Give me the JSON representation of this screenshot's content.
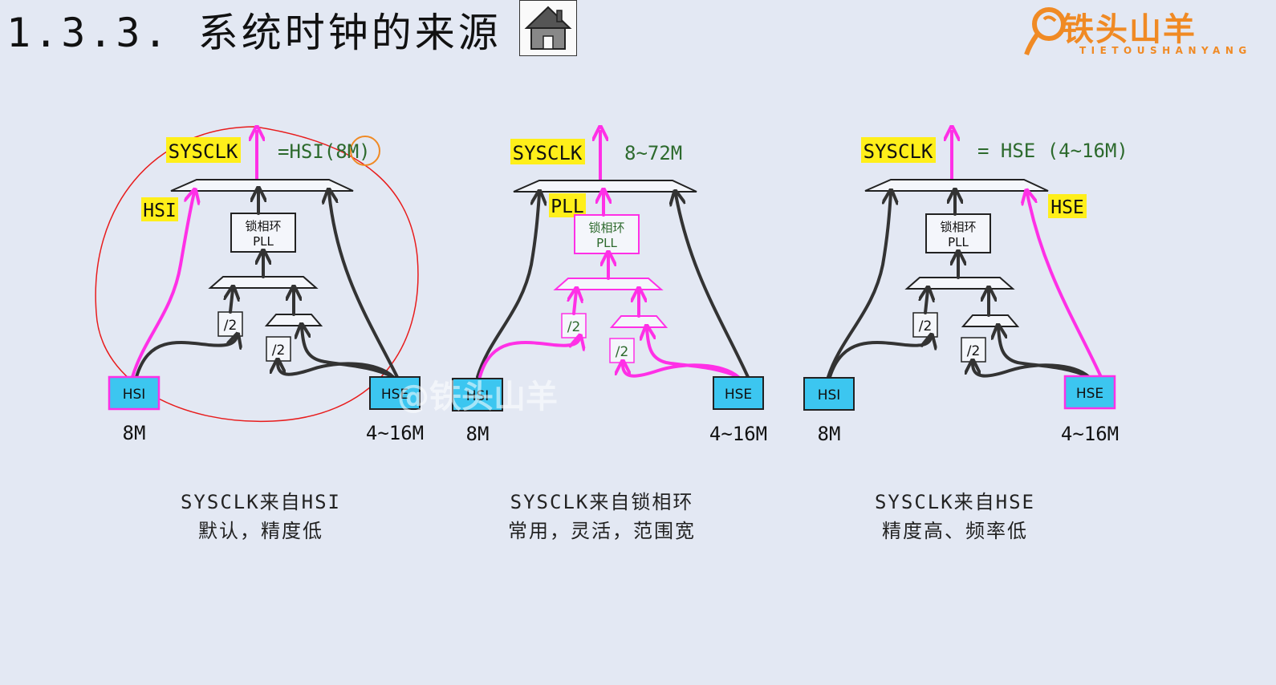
{
  "page": {
    "title": "1.3.3. 系统时钟的来源",
    "home_icon": "home-icon",
    "logo": {
      "brand": "铁头山羊",
      "subtitle": "TIETOUSHANYANG"
    },
    "watermark": "@铁头山羊"
  },
  "colors": {
    "background": "#e3e8f3",
    "highlight": "#ffef1a",
    "box_fill": "#3cc6f0",
    "active_path": "#ff30e6",
    "normal_path": "#333333",
    "annotation": "#e81c1c",
    "value_text": "#2d6a2d"
  },
  "panels": [
    {
      "sysclk_label": "SYSCLK",
      "sysclk_value": "=HSI(8M)",
      "side_label": "HSI",
      "pll_line1": "锁相环",
      "pll_line2": "PLL",
      "div_a": "/2",
      "div_b": "/2",
      "hsi_label": "HSI",
      "hse_label": "HSE",
      "hsi_freq": "8M",
      "hse_freq": "4~16M",
      "caption_line1": "SYSCLK来自HSI",
      "caption_line2": "默认，精度低"
    },
    {
      "sysclk_label": "SYSCLK",
      "sysclk_value": "8~72M",
      "side_label": "PLL",
      "pll_line1": "锁相环",
      "pll_line2": "PLL",
      "div_a": "/2",
      "div_b": "/2",
      "hsi_label": "HSI",
      "hse_label": "HSE",
      "hsi_freq": "8M",
      "hse_freq": "4~16M",
      "caption_line1": "SYSCLK来自锁相环",
      "caption_line2": "常用，灵活，范围宽"
    },
    {
      "sysclk_label": "SYSCLK",
      "sysclk_value": "= HSE (4~16M)",
      "side_label": "HSE",
      "pll_line1": "锁相环",
      "pll_line2": "PLL",
      "div_a": "/2",
      "div_b": "/2",
      "hsi_label": "HSI",
      "hse_label": "HSE",
      "hsi_freq": "8M",
      "hse_freq": "4~16M",
      "caption_line1": "SYSCLK来自HSE",
      "caption_line2": "精度高、频率低"
    }
  ]
}
